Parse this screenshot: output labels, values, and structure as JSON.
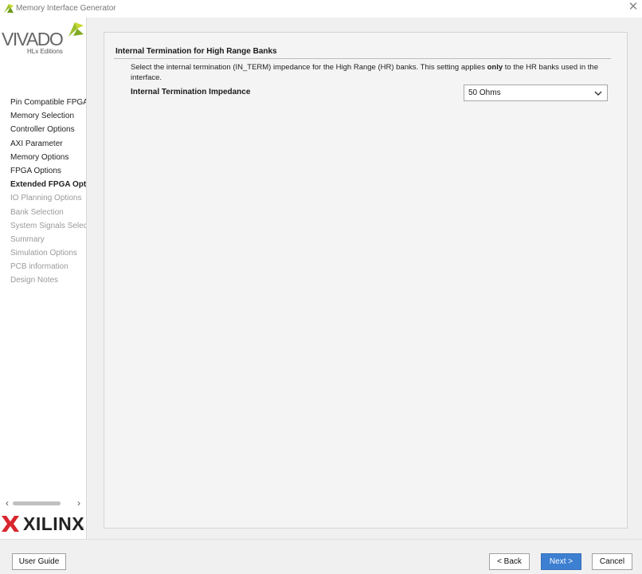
{
  "window": {
    "title": "Memory Interface Generator",
    "app_icon": "vivado-leaf-icon",
    "close_icon": "close-icon"
  },
  "branding": {
    "vivado_word": "VIVADO",
    "vivado_sub": "HLx Editions",
    "xilinx_word": "XILINX",
    "xilinx_reg": "®",
    "leaf_colors": [
      "#9bbf2b",
      "#c7d92f"
    ],
    "xilinx_red": "#d8262e"
  },
  "steps": [
    {
      "label": "Pin Compatible FPGAs",
      "state": "done"
    },
    {
      "label": "Memory Selection",
      "state": "done"
    },
    {
      "label": "Controller Options",
      "state": "done"
    },
    {
      "label": "AXI Parameter",
      "state": "done"
    },
    {
      "label": "Memory Options",
      "state": "done"
    },
    {
      "label": "FPGA Options",
      "state": "done"
    },
    {
      "label": "Extended FPGA Options",
      "state": "active"
    },
    {
      "label": "IO Planning Options",
      "state": "disabled"
    },
    {
      "label": "Bank Selection",
      "state": "disabled"
    },
    {
      "label": "System Signals Selection",
      "state": "disabled"
    },
    {
      "label": "Summary",
      "state": "disabled"
    },
    {
      "label": "Simulation Options",
      "state": "disabled"
    },
    {
      "label": "PCB information",
      "state": "disabled"
    },
    {
      "label": "Design Notes",
      "state": "disabled"
    }
  ],
  "panel": {
    "section_title": "Internal Termination for High Range Banks",
    "desc_before": "Select the internal termination (IN_TERM) impedance for the High Range (HR) banks. This setting applies ",
    "desc_bold": "only",
    "desc_after": " to the HR banks used in the interface.",
    "field_label": "Internal Termination Impedance",
    "select_value": "50 Ohms"
  },
  "buttons": {
    "user_guide": "User Guide",
    "back": "< Back",
    "next": "Next >",
    "cancel": "Cancel"
  },
  "colors": {
    "accent": "#3d7fd1"
  }
}
